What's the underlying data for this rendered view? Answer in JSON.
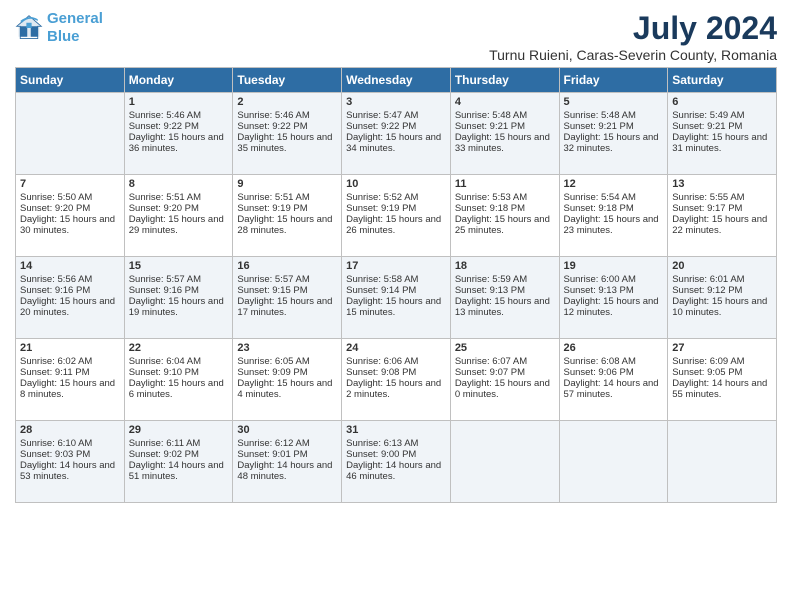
{
  "logo": {
    "line1": "General",
    "line2": "Blue"
  },
  "title": "July 2024",
  "subtitle": "Turnu Ruieni, Caras-Severin County, Romania",
  "days": [
    "Sunday",
    "Monday",
    "Tuesday",
    "Wednesday",
    "Thursday",
    "Friday",
    "Saturday"
  ],
  "weeks": [
    [
      {
        "num": "",
        "empty": true
      },
      {
        "num": "1",
        "rise": "5:46 AM",
        "set": "9:22 PM",
        "daylight": "15 hours and 36 minutes."
      },
      {
        "num": "2",
        "rise": "5:46 AM",
        "set": "9:22 PM",
        "daylight": "15 hours and 35 minutes."
      },
      {
        "num": "3",
        "rise": "5:47 AM",
        "set": "9:22 PM",
        "daylight": "15 hours and 34 minutes."
      },
      {
        "num": "4",
        "rise": "5:48 AM",
        "set": "9:21 PM",
        "daylight": "15 hours and 33 minutes."
      },
      {
        "num": "5",
        "rise": "5:48 AM",
        "set": "9:21 PM",
        "daylight": "15 hours and 32 minutes."
      },
      {
        "num": "6",
        "rise": "5:49 AM",
        "set": "9:21 PM",
        "daylight": "15 hours and 31 minutes."
      }
    ],
    [
      {
        "num": "7",
        "rise": "5:50 AM",
        "set": "9:20 PM",
        "daylight": "15 hours and 30 minutes."
      },
      {
        "num": "8",
        "rise": "5:51 AM",
        "set": "9:20 PM",
        "daylight": "15 hours and 29 minutes."
      },
      {
        "num": "9",
        "rise": "5:51 AM",
        "set": "9:19 PM",
        "daylight": "15 hours and 28 minutes."
      },
      {
        "num": "10",
        "rise": "5:52 AM",
        "set": "9:19 PM",
        "daylight": "15 hours and 26 minutes."
      },
      {
        "num": "11",
        "rise": "5:53 AM",
        "set": "9:18 PM",
        "daylight": "15 hours and 25 minutes."
      },
      {
        "num": "12",
        "rise": "5:54 AM",
        "set": "9:18 PM",
        "daylight": "15 hours and 23 minutes."
      },
      {
        "num": "13",
        "rise": "5:55 AM",
        "set": "9:17 PM",
        "daylight": "15 hours and 22 minutes."
      }
    ],
    [
      {
        "num": "14",
        "rise": "5:56 AM",
        "set": "9:16 PM",
        "daylight": "15 hours and 20 minutes."
      },
      {
        "num": "15",
        "rise": "5:57 AM",
        "set": "9:16 PM",
        "daylight": "15 hours and 19 minutes."
      },
      {
        "num": "16",
        "rise": "5:57 AM",
        "set": "9:15 PM",
        "daylight": "15 hours and 17 minutes."
      },
      {
        "num": "17",
        "rise": "5:58 AM",
        "set": "9:14 PM",
        "daylight": "15 hours and 15 minutes."
      },
      {
        "num": "18",
        "rise": "5:59 AM",
        "set": "9:13 PM",
        "daylight": "15 hours and 13 minutes."
      },
      {
        "num": "19",
        "rise": "6:00 AM",
        "set": "9:13 PM",
        "daylight": "15 hours and 12 minutes."
      },
      {
        "num": "20",
        "rise": "6:01 AM",
        "set": "9:12 PM",
        "daylight": "15 hours and 10 minutes."
      }
    ],
    [
      {
        "num": "21",
        "rise": "6:02 AM",
        "set": "9:11 PM",
        "daylight": "15 hours and 8 minutes."
      },
      {
        "num": "22",
        "rise": "6:04 AM",
        "set": "9:10 PM",
        "daylight": "15 hours and 6 minutes."
      },
      {
        "num": "23",
        "rise": "6:05 AM",
        "set": "9:09 PM",
        "daylight": "15 hours and 4 minutes."
      },
      {
        "num": "24",
        "rise": "6:06 AM",
        "set": "9:08 PM",
        "daylight": "15 hours and 2 minutes."
      },
      {
        "num": "25",
        "rise": "6:07 AM",
        "set": "9:07 PM",
        "daylight": "15 hours and 0 minutes."
      },
      {
        "num": "26",
        "rise": "6:08 AM",
        "set": "9:06 PM",
        "daylight": "14 hours and 57 minutes."
      },
      {
        "num": "27",
        "rise": "6:09 AM",
        "set": "9:05 PM",
        "daylight": "14 hours and 55 minutes."
      }
    ],
    [
      {
        "num": "28",
        "rise": "6:10 AM",
        "set": "9:03 PM",
        "daylight": "14 hours and 53 minutes."
      },
      {
        "num": "29",
        "rise": "6:11 AM",
        "set": "9:02 PM",
        "daylight": "14 hours and 51 minutes."
      },
      {
        "num": "30",
        "rise": "6:12 AM",
        "set": "9:01 PM",
        "daylight": "14 hours and 48 minutes."
      },
      {
        "num": "31",
        "rise": "6:13 AM",
        "set": "9:00 PM",
        "daylight": "14 hours and 46 minutes."
      },
      {
        "num": "",
        "empty": true
      },
      {
        "num": "",
        "empty": true
      },
      {
        "num": "",
        "empty": true
      }
    ]
  ]
}
